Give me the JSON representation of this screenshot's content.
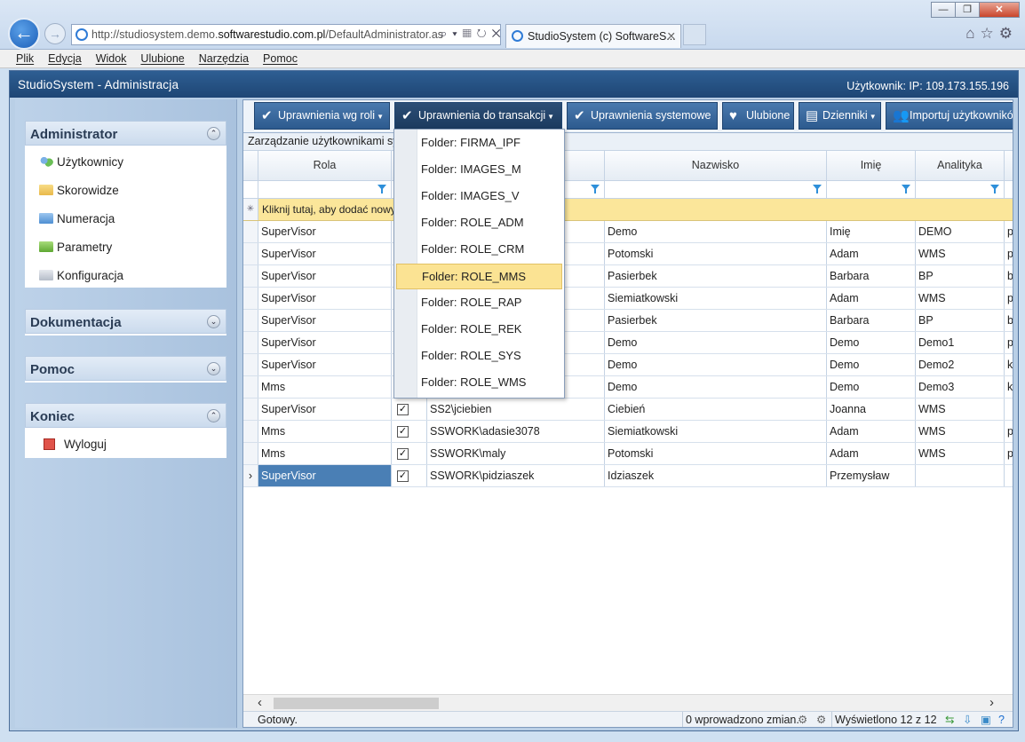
{
  "browser": {
    "url_prefix": "http://studiosystem.demo.",
    "url_domain": "softwarestudio.com.pl",
    "url_suffix": "/DefaultAdministrator.as",
    "tab_title": "StudioSystem (c) SoftwareS...",
    "tab_close": "✕",
    "menu": [
      "Plik",
      "Edycja",
      "Widok",
      "Ulubione",
      "Narzędzia",
      "Pomoc"
    ]
  },
  "app": {
    "title": "StudioSystem - Administracja",
    "user_info": "Użytkownik: IP: 109.173.155.196"
  },
  "sidebar": {
    "administrator": {
      "title": "Administrator",
      "items": [
        "Użytkownicy",
        "Skorowidze",
        "Numeracja",
        "Parametry",
        "Konfiguracja"
      ]
    },
    "dokumentacja": "Dokumentacja",
    "pomoc": "Pomoc",
    "koniec": {
      "title": "Koniec",
      "items": [
        "Wyloguj"
      ]
    }
  },
  "toolbar": {
    "btn_roles": "Uprawnienia wg roli",
    "btn_transactions": "Uprawnienia do transakcji",
    "btn_system": "Uprawnienia systemowe",
    "btn_favorites": "Ulubione",
    "btn_logs": "Dzienniki",
    "btn_import": "Importuj użytkowników"
  },
  "grid": {
    "group_header": "Zarządzanie użytkownikami systemu",
    "columns": {
      "rola": "Rola",
      "nazwisko": "Nazwisko",
      "imie": "Imię",
      "analityka": "Analityka"
    },
    "add_row": "Kliknij tutaj, aby dodać nowy",
    "add_marker": "✳",
    "rows": [
      {
        "rola": "SuperVisor",
        "login": "",
        "nazwisko": "Demo",
        "imie": "Imię",
        "analityka": "DEMO",
        "extra": "p"
      },
      {
        "rola": "SuperVisor",
        "login": "",
        "nazwisko": "Potomski",
        "imie": "Adam",
        "analityka": "WMS",
        "extra": "p"
      },
      {
        "rola": "SuperVisor",
        "login": "",
        "nazwisko": "Pasierbek",
        "imie": "Barbara",
        "analityka": "BP",
        "extra": "b"
      },
      {
        "rola": "SuperVisor",
        "login": "",
        "nazwisko": "Siemiatkowski",
        "imie": "Adam",
        "analityka": "WMS",
        "extra": "p"
      },
      {
        "rola": "SuperVisor",
        "login": "",
        "nazwisko": "Pasierbek",
        "imie": "Barbara",
        "analityka": "BP",
        "extra": "b"
      },
      {
        "rola": "SuperVisor",
        "login": "",
        "nazwisko": "Demo",
        "imie": "Demo",
        "analityka": "Demo1",
        "extra": "p"
      },
      {
        "rola": "SuperVisor",
        "login": "",
        "nazwisko": "Demo",
        "imie": "Demo",
        "analityka": "Demo2",
        "extra": "k"
      },
      {
        "rola": "Mms",
        "login": "",
        "nazwisko": "Demo",
        "imie": "Demo",
        "analityka": "Demo3",
        "extra": "k"
      },
      {
        "rola": "SuperVisor",
        "login": "SS2\\jciebien",
        "nazwisko": "Ciebień",
        "imie": "Joanna",
        "analityka": "WMS",
        "extra": ""
      },
      {
        "rola": "Mms",
        "login": "SSWORK\\adasie3078",
        "nazwisko": "Siemiatkowski",
        "imie": "Adam",
        "analityka": "WMS",
        "extra": "p"
      },
      {
        "rola": "Mms",
        "login": "SSWORK\\maly",
        "nazwisko": "Potomski",
        "imie": "Adam",
        "analityka": "WMS",
        "extra": "p"
      },
      {
        "rola": "SuperVisor",
        "login": "SSWORK\\pidziaszek",
        "nazwisko": "Idziaszek",
        "imie": "Przemysław",
        "analityka": "",
        "extra": ""
      }
    ],
    "row_pointer": "›"
  },
  "dropdown": {
    "items": [
      "Folder: FIRMA_IPF",
      "Folder: IMAGES_M",
      "Folder: IMAGES_V",
      "Folder: ROLE_ADM",
      "Folder: ROLE_CRM",
      "Folder: ROLE_MMS",
      "Folder: ROLE_RAP",
      "Folder: ROLE_REK",
      "Folder: ROLE_SYS",
      "Folder: ROLE_WMS"
    ],
    "highlighted": "Folder: ROLE_MMS"
  },
  "status": {
    "ready": "Gotowy.",
    "changes": "0 wprowadzono zmian.",
    "shown": "Wyświetlono 12 z 12"
  },
  "colors": {
    "accent": "#2d5a8e",
    "highlight": "#fbe393",
    "selected": "#4a7fb5"
  }
}
